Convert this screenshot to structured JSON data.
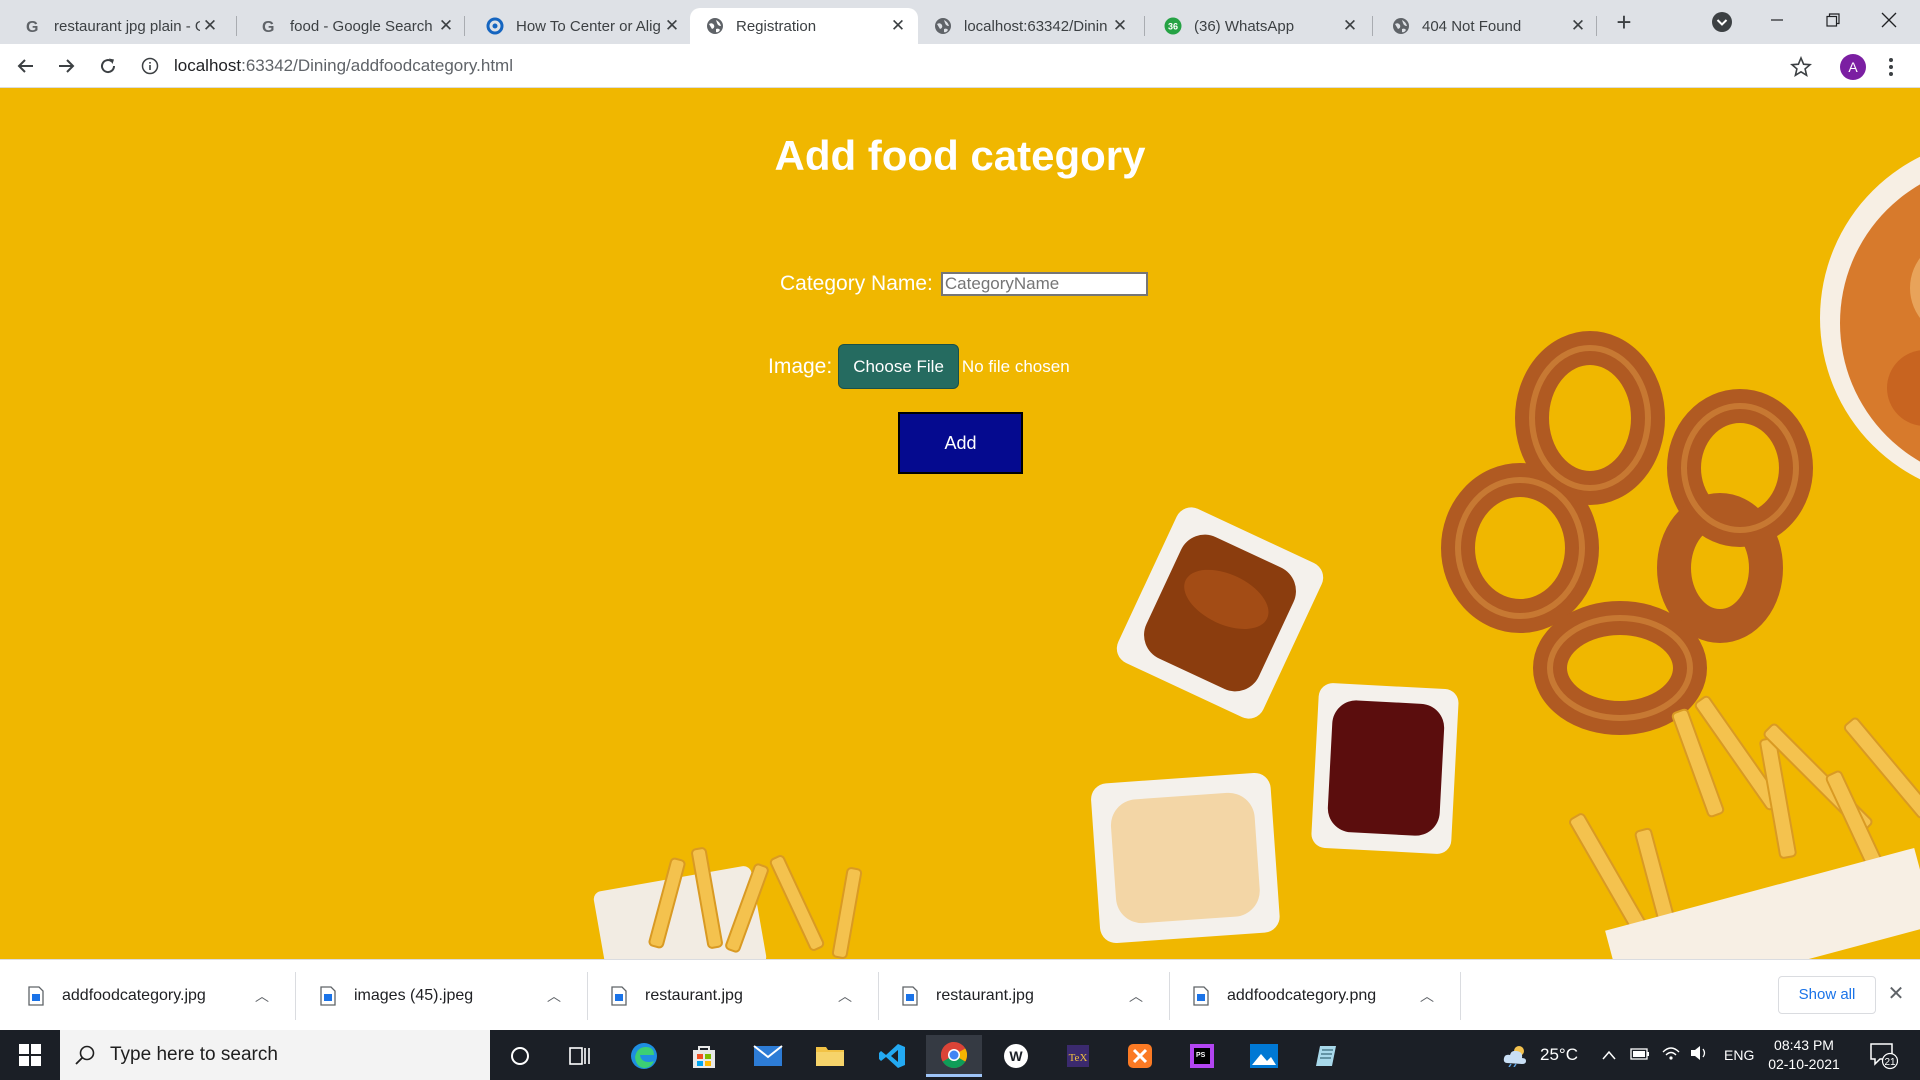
{
  "browser": {
    "tabs": [
      {
        "title": "restaurant jpg plain - G",
        "icon": "google-icon",
        "active": false
      },
      {
        "title": "food - Google Search",
        "icon": "google-icon",
        "active": false
      },
      {
        "title": "How To Center or Alig",
        "icon": "site-icon",
        "active": false
      },
      {
        "title": "Registration",
        "icon": "globe-icon",
        "active": true
      },
      {
        "title": "localhost:63342/Dinin",
        "icon": "globe-icon",
        "active": false
      },
      {
        "title": "(36) WhatsApp",
        "icon": "whatsapp-icon",
        "active": false,
        "badge": "36"
      },
      {
        "title": "404 Not Found",
        "icon": "globe-icon",
        "active": false
      }
    ],
    "url_host": "localhost",
    "url_rest": ":63342/Dining/addfoodcategory.html",
    "profile_initial": "A"
  },
  "page": {
    "title": "Add food category",
    "category_label": "Category Name:",
    "category_placeholder": "CategoryName",
    "category_value": "",
    "image_label": "Image:",
    "choose_file_label": "Choose File",
    "no_file_text": "No file chosen",
    "add_label": "Add"
  },
  "downloads": {
    "items": [
      {
        "name": "addfoodcategory.jpg"
      },
      {
        "name": "images (45).jpeg"
      },
      {
        "name": "restaurant.jpg"
      },
      {
        "name": "restaurant.jpg"
      },
      {
        "name": "addfoodcategory.png"
      }
    ],
    "show_all_label": "Show all"
  },
  "taskbar": {
    "search_placeholder": "Type here to search",
    "temperature": "25°C",
    "language": "ENG",
    "time": "08:43 PM",
    "date": "02-10-2021",
    "notification_count": "21"
  },
  "colors": {
    "page_background": "#f0b700",
    "choose_file_button": "#256b60",
    "add_button": "#050a8f",
    "tab_strip": "#dee1e6"
  }
}
